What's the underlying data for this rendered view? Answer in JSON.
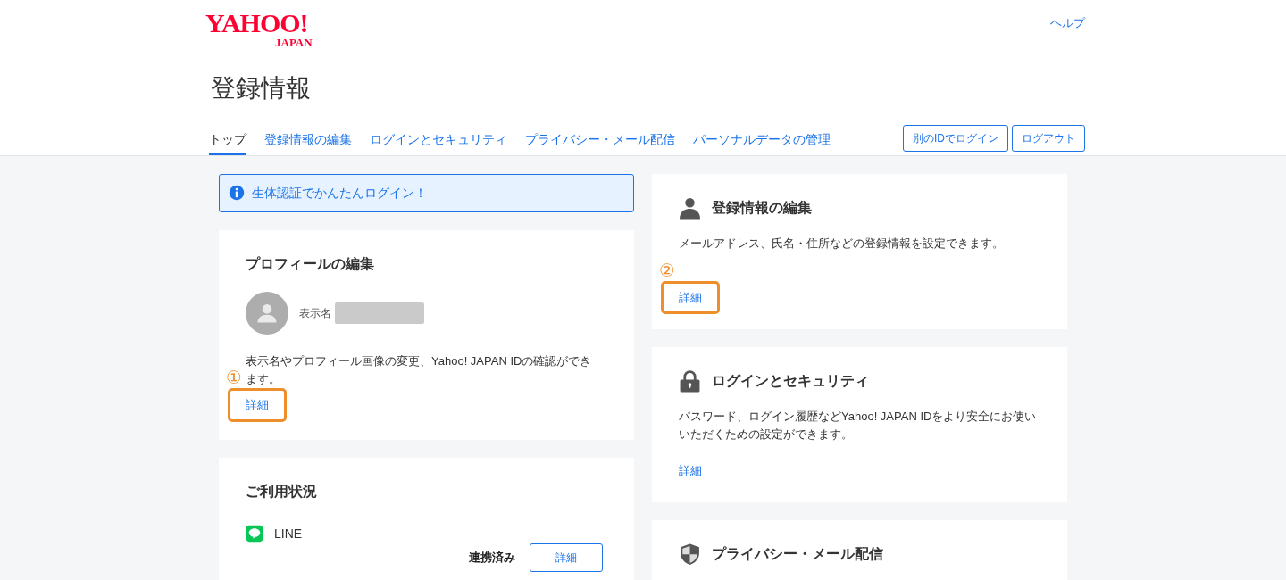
{
  "logo": {
    "main": "YAHOO!",
    "sub": "JAPAN"
  },
  "help_link": "ヘルプ",
  "page_title": "登録情報",
  "tabs": [
    {
      "label": "トップ",
      "selected": true
    },
    {
      "label": "登録情報の編集",
      "selected": false
    },
    {
      "label": "ログインとセキュリティ",
      "selected": false
    },
    {
      "label": "プライバシー・メール配信",
      "selected": false
    },
    {
      "label": "パーソナルデータの管理",
      "selected": false
    }
  ],
  "header_buttons": [
    "別のIDでログイン",
    "ログアウト"
  ],
  "notice": {
    "text": "生体認証でかんたんログイン！"
  },
  "profile_card": {
    "title": "プロフィールの編集",
    "display_name_label": "表示名",
    "description": "表示名やプロフィール画像の変更、Yahoo! JAPAN IDの確認ができます。",
    "link": {
      "label": "詳細",
      "highlighted": true,
      "callout": "①"
    }
  },
  "usage_card": {
    "title": "ご利用状況",
    "services": [
      {
        "name": "LINE",
        "status": "連携済み",
        "button": "詳細"
      }
    ]
  },
  "right_cards": [
    {
      "kind": "person",
      "title": "登録情報の編集",
      "description": "メールアドレス、氏名・住所などの登録情報を設定できます。",
      "link": {
        "label": "詳細",
        "highlighted": true,
        "callout": "②"
      }
    },
    {
      "kind": "lock",
      "title": "ログインとセキュリティ",
      "description": "パスワード、ログイン履歴などYahoo! JAPAN IDをより安全にお使いいただくための設定ができます。",
      "link": {
        "label": "詳細",
        "highlighted": false
      }
    },
    {
      "kind": "shield",
      "title": "プライバシー・メール配信"
    }
  ]
}
